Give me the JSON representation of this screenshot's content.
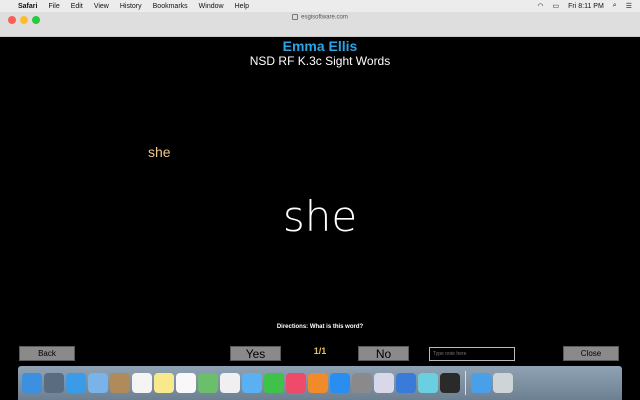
{
  "menubar": {
    "apple": "",
    "items": [
      "Safari",
      "File",
      "Edit",
      "View",
      "History",
      "Bookmarks",
      "Window",
      "Help"
    ],
    "clock": "Fri 8:11 PM"
  },
  "browser": {
    "url": "esgisoftware.com"
  },
  "header": {
    "student_name": "Emma Ellis",
    "assessment": "NSD RF K.3c Sight Words"
  },
  "card": {
    "hint_word": "she",
    "word": "she",
    "directions": "Directions: What is this word?"
  },
  "controls": {
    "back": "Back",
    "yes": "Yes",
    "progress": "1/1",
    "no": "No",
    "note_placeholder": "Type note here",
    "close": "Close"
  },
  "dock": {
    "apps": [
      {
        "name": "finder",
        "color": "#3d8fe0"
      },
      {
        "name": "launchpad",
        "color": "#5a6d80"
      },
      {
        "name": "safari",
        "color": "#3a9be8"
      },
      {
        "name": "mail",
        "color": "#7ab3e8"
      },
      {
        "name": "contacts",
        "color": "#b08a5a"
      },
      {
        "name": "calendar",
        "color": "#f4f4f4"
      },
      {
        "name": "notes",
        "color": "#f7e98c"
      },
      {
        "name": "reminders",
        "color": "#f8f8f8"
      },
      {
        "name": "maps",
        "color": "#6cbf6a"
      },
      {
        "name": "photos",
        "color": "#f0f0f0"
      },
      {
        "name": "messages",
        "color": "#5ab0f0"
      },
      {
        "name": "facetime",
        "color": "#3fc24a"
      },
      {
        "name": "music",
        "color": "#f04a6a"
      },
      {
        "name": "books",
        "color": "#f08a2a"
      },
      {
        "name": "app-store",
        "color": "#2a8ef0"
      },
      {
        "name": "system-preferences",
        "color": "#8a8a8a"
      },
      {
        "name": "preview",
        "color": "#d8d8e8"
      },
      {
        "name": "keynote",
        "color": "#3a7ad8"
      },
      {
        "name": "image-capture",
        "color": "#6ad0e0"
      },
      {
        "name": "quicktime",
        "color": "#2a2a2a"
      },
      {
        "name": "downloads",
        "color": "#4aa0e8"
      },
      {
        "name": "trash",
        "color": "#cfd4d8"
      }
    ]
  }
}
